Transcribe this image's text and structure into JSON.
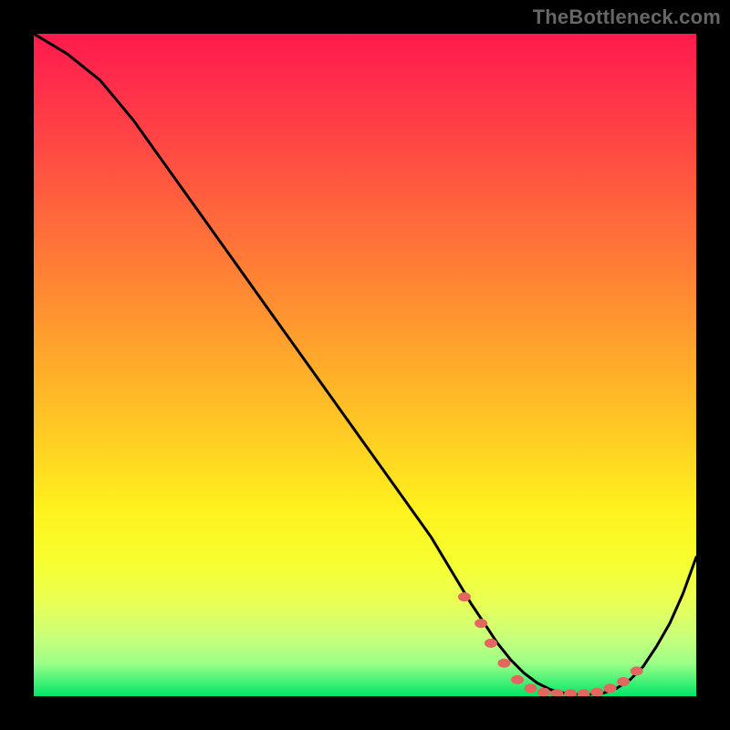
{
  "watermark": "TheBottleneck.com",
  "colors": {
    "frame_bg": "#000000",
    "curve_stroke": "#000000",
    "marker_fill": "#e2675e",
    "gradient_top": "#ff1a4d",
    "gradient_bottom": "#00e668"
  },
  "chart_data": {
    "type": "line",
    "title": "",
    "xlabel": "",
    "ylabel": "",
    "xlim": [
      0,
      100
    ],
    "ylim": [
      0,
      100
    ],
    "grid": false,
    "legend": false,
    "x": [
      0,
      5,
      10,
      15,
      20,
      25,
      30,
      35,
      40,
      45,
      50,
      55,
      60,
      63,
      66,
      68,
      70,
      72,
      74,
      76,
      78,
      80,
      82,
      84,
      86,
      88,
      90,
      92,
      94,
      96,
      98,
      100
    ],
    "y": [
      100,
      97,
      93,
      87,
      80,
      73,
      66,
      59,
      52,
      45,
      38,
      31,
      24,
      19,
      14,
      11,
      8,
      5.5,
      3.5,
      2,
      1,
      0.5,
      0.3,
      0.3,
      0.5,
      1.2,
      2.5,
      4.5,
      7.5,
      11,
      15.5,
      21
    ],
    "markers": {
      "x": [
        65,
        67.5,
        69,
        71,
        73,
        75,
        77,
        79,
        81,
        83,
        85,
        87,
        89,
        91
      ],
      "y": [
        15,
        11,
        8,
        5,
        2.5,
        1.2,
        0.6,
        0.4,
        0.4,
        0.4,
        0.6,
        1.2,
        2.2,
        3.8
      ]
    }
  }
}
